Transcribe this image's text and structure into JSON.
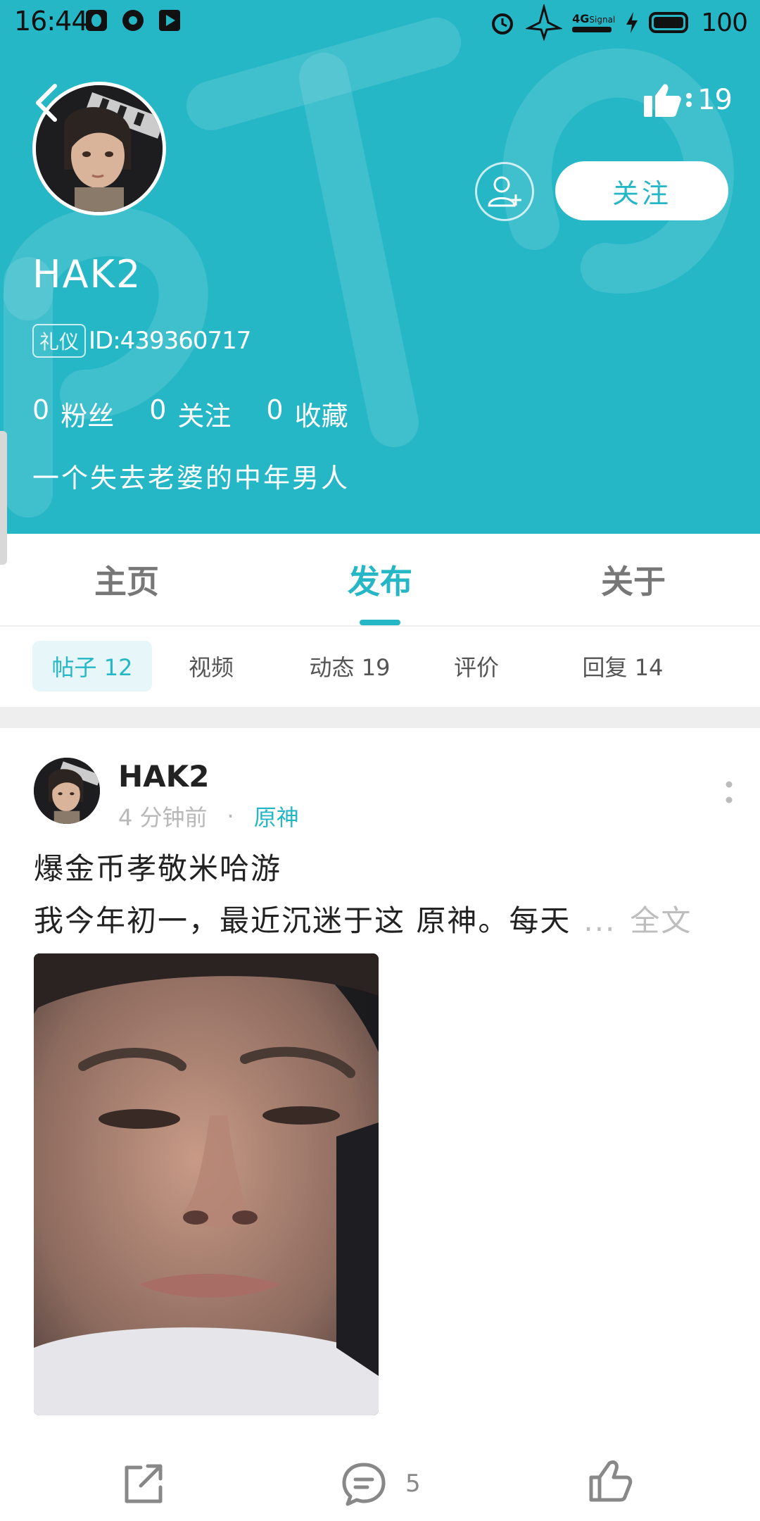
{
  "status_bar": {
    "time": "16:44",
    "network": "4G",
    "signal_label": "Signal",
    "battery": "100"
  },
  "profile": {
    "username": "HAK2",
    "badge": "礼仪",
    "id_text": "ID:439360717",
    "like_count": "19",
    "follow_label": "关注",
    "stats": [
      {
        "count": "0",
        "label": "粉丝"
      },
      {
        "count": "0",
        "label": "关注"
      },
      {
        "count": "0",
        "label": "收藏"
      }
    ],
    "bio": "一个失去老婆的中年男人"
  },
  "main_tabs": [
    {
      "label": "主页",
      "active": false
    },
    {
      "label": "发布",
      "active": true
    },
    {
      "label": "关于",
      "active": false
    }
  ],
  "sub_tabs": [
    {
      "label": "帖子 12",
      "active": true
    },
    {
      "label": "视频",
      "active": false
    },
    {
      "label": "动态 19",
      "active": false
    },
    {
      "label": "评价",
      "active": false
    },
    {
      "label": "回复 14",
      "active": false
    }
  ],
  "post": {
    "author": "HAK2",
    "time": "4 分钟前",
    "separator": "·",
    "tag": "原神",
    "title": "爆金币孝敬米哈游",
    "excerpt": "我今年初一，最近沉迷于这 原神。每天",
    "ellipsis": "...",
    "fulltext_label": "全文",
    "comment_count": "5"
  },
  "colors": {
    "accent": "#26b7c6",
    "header_bg": "#26b7c6"
  }
}
